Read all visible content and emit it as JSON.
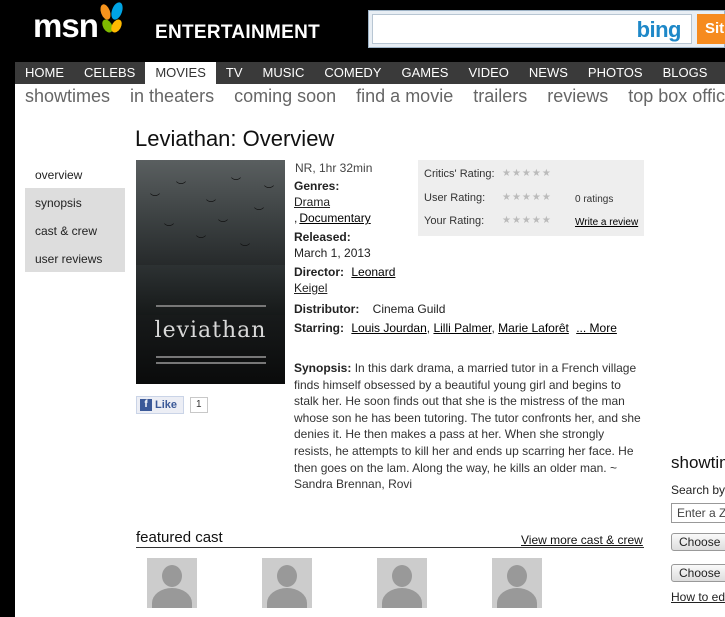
{
  "header": {
    "logo": "msn",
    "section": "ENTERTAINMENT",
    "search_placeholder": "",
    "search_brand": "bing",
    "search_button": "Sit"
  },
  "main_nav": [
    "HOME",
    "CELEBS",
    "MOVIES",
    "TV",
    "MUSIC",
    "COMEDY",
    "GAMES",
    "VIDEO",
    "NEWS",
    "PHOTOS",
    "BLOGS"
  ],
  "sub_nav": [
    "showtimes",
    "in theaters",
    "coming soon",
    "find a movie",
    "trailers",
    "reviews",
    "top box office"
  ],
  "page_title": "Leviathan:  Overview",
  "left_nav": [
    "overview",
    "synopsis",
    "cast & crew",
    "user reviews"
  ],
  "poster": {
    "title": "leviathan"
  },
  "movie": {
    "rating_runtime": "NR, 1hr 32min",
    "genres_label": "Genres:",
    "genre1": "Drama",
    "genre2": "Documentary",
    "released_label": "Released:",
    "released": "March 1, 2013",
    "director_label": "Director:",
    "director_first": "Leonard",
    "director_last": "Keigel",
    "distributor_label": "Distributor:",
    "distributor": "Cinema Guild",
    "starring_label": "Starring:",
    "star1": "Louis Jourdan",
    "star2": "Lilli Palmer",
    "star3": "Marie Laforêt",
    "more": "... More"
  },
  "ratings": {
    "critics_label": "Critics' Rating:",
    "user_label": "User Rating:",
    "user_count": "0 ratings",
    "your_label": "Your Rating:",
    "write_review": "Write a review",
    "stars": "★★★★★"
  },
  "like": {
    "label": "Like",
    "count": "1"
  },
  "synopsis": {
    "label": "Synopsis:",
    "text": "In this dark drama, a married tutor in a French village finds himself obsessed by a beautiful young girl and begins to stalk her. He soon finds out that she is the mistress of the man whose son he has been tutoring. The tutor confronts her, and she denies it. He then makes a pass at her. When she strongly resists, he attempts to kill her and ends up scarring her face. He then goes on the lam. Along the way, he kills an older man. ~ Sandra Brennan, Rovi"
  },
  "featured_cast": {
    "title": "featured cast",
    "link": "View more cast & crew"
  },
  "showtimes_box": {
    "title": "showtimes",
    "search_by": "Search by",
    "zip_placeholder": "Enter a Zip",
    "choose1": "Choose",
    "choose2": "Choose",
    "how_to": "How to edit"
  }
}
